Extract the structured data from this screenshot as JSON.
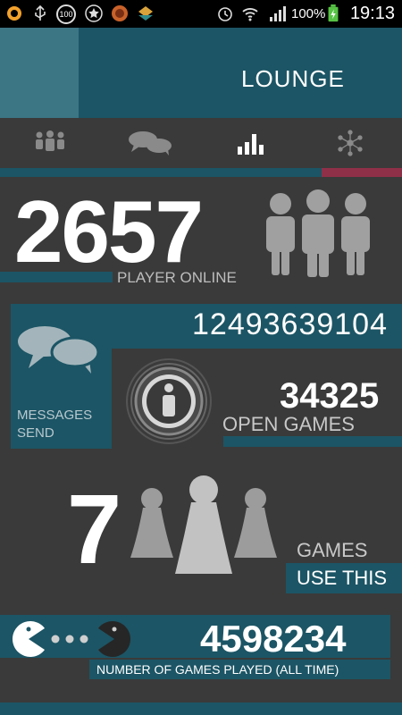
{
  "status_bar": {
    "battery_percent": "100%",
    "time": "19:13",
    "notification_badge": "100",
    "icons": [
      "app-icon-orange",
      "usb-icon",
      "badge-100-icon",
      "star-icon",
      "vlc-icon",
      "app-icon-teal",
      "alarm-icon",
      "wifi-icon",
      "signal-icon",
      "battery-charging-icon"
    ]
  },
  "header": {
    "title": "LOUNGE"
  },
  "tabs": [
    {
      "icon": "group-icon"
    },
    {
      "icon": "chat-icon"
    },
    {
      "icon": "stats-icon",
      "active": true
    },
    {
      "icon": "network-icon"
    }
  ],
  "players": {
    "count": "2657",
    "label": "PLAYER ONLINE"
  },
  "messages": {
    "count": "12493639104",
    "label_line1": "MESSAGES",
    "label_line2": "SEND"
  },
  "open_games": {
    "count": "34325",
    "label": "OPEN GAMES"
  },
  "games": {
    "count": "7",
    "label": "GAMES",
    "sublabel": "USE THIS"
  },
  "games_played": {
    "count": "4598234",
    "label": "NUMBER OF GAMES PLAYED (ALL TIME)"
  },
  "colors": {
    "accent_blue": "#1c5565",
    "accent_light": "#3c7584",
    "accent_red": "#8f3048",
    "background": "#3a3a3a"
  }
}
